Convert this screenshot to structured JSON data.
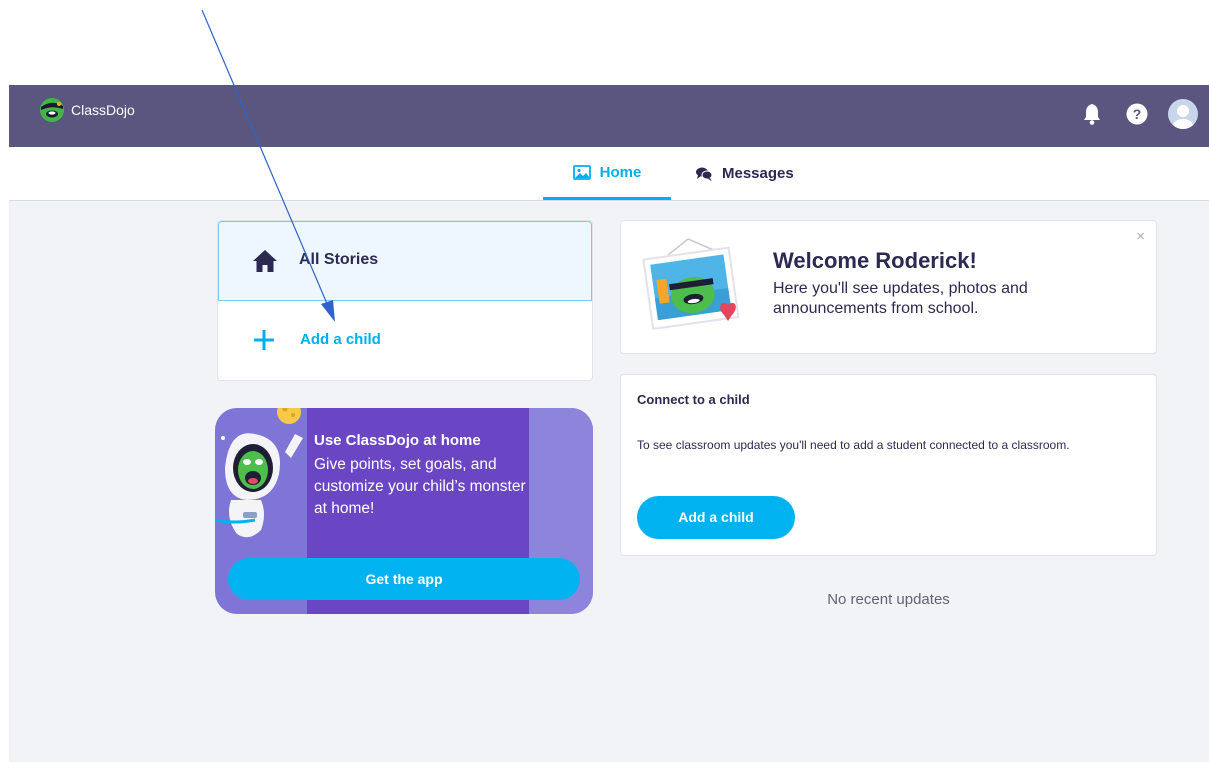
{
  "header": {
    "brand_name": "ClassDojo",
    "brand_color": "#5a5680",
    "icons": [
      "bell-icon",
      "help-icon",
      "avatar"
    ]
  },
  "nav": {
    "tabs": [
      {
        "label": "Home",
        "icon": "image-icon",
        "active": true
      },
      {
        "label": "Messages",
        "icon": "chat-icon",
        "active": false
      }
    ],
    "accent_color": "#00aeef"
  },
  "sidebar": {
    "all_stories_label": "All Stories",
    "add_child_label": "Add a child"
  },
  "promo": {
    "title": "Use ClassDojo at home",
    "body": "Give points, set goals, and customize your child’s monster at home!",
    "button_label": "Get the app"
  },
  "welcome": {
    "title": "Welcome Roderick!",
    "body": "Here you'll see updates, photos and announcements from school.",
    "close_label": "×"
  },
  "connect": {
    "title": "Connect to a child",
    "body": "To see classroom updates you'll need to add a student connected to a classroom.",
    "button_label": "Add a child"
  },
  "feed": {
    "empty_text": "No recent updates"
  }
}
